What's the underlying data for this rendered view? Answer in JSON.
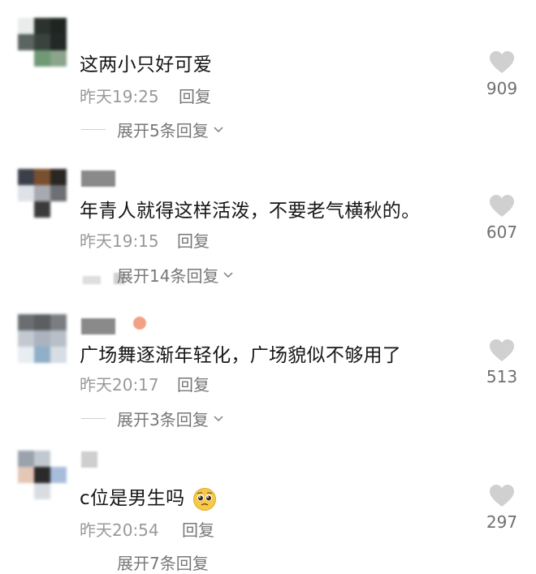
{
  "comments": [
    {
      "text": "这两小只好可爱",
      "time": "昨天19:25",
      "reply_label": "回复",
      "expand_label": "展开5条回复",
      "likes": "909"
    },
    {
      "text": "年青人就得这样活泼，不要老气横秋的。",
      "time": "昨天19:15",
      "reply_label": "回复",
      "expand_label": "展开14条回复",
      "likes": "607"
    },
    {
      "text": "广场舞逐渐年轻化，广场貌似不够用了",
      "time": "昨天20:17",
      "reply_label": "回复",
      "expand_label": "展开3条回复",
      "likes": "513"
    },
    {
      "text": "c位是男生吗",
      "text_emoji": "pleading-face-emoji",
      "time": "昨天20:54",
      "reply_label": "回复",
      "expand_label": "展开7条回复",
      "likes": "297"
    }
  ],
  "icons": {
    "like": "heart-icon",
    "expand": "chevron-down-icon"
  },
  "colors": {
    "text": "#161616",
    "meta": "#999999",
    "secondary": "#777777",
    "heart": "#d0d0d0"
  }
}
